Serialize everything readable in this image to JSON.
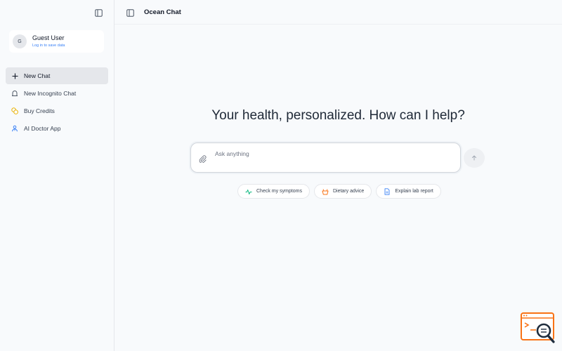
{
  "sidebar": {
    "user": {
      "initial": "G",
      "name": "Guest User",
      "subtitle": "Log in to save data"
    },
    "items": [
      {
        "label": "New Chat",
        "icon": "plus-icon",
        "active": true
      },
      {
        "label": "New Incognito Chat",
        "icon": "incognito-icon"
      },
      {
        "label": "Buy Credits",
        "icon": "coins-icon",
        "color": "#eab308"
      },
      {
        "label": "AI Doctor App",
        "icon": "doctor-icon",
        "color": "#3b82f6"
      }
    ]
  },
  "header": {
    "title": "Ocean Chat"
  },
  "main": {
    "headline": "Your health, personalized. How can I help?",
    "composer": {
      "placeholder": "Ask anything",
      "value": ""
    },
    "chips": [
      {
        "label": "Check my symptoms",
        "icon": "pulse-icon",
        "color": "#10b981"
      },
      {
        "label": "Dietary advice",
        "icon": "bowl-icon",
        "color": "#f97316"
      },
      {
        "label": "Explain lab report",
        "icon": "document-icon",
        "color": "#3b82f6"
      }
    ]
  },
  "colors": {
    "accent": "#3b82f6",
    "coin": "#eab308",
    "pulse": "#10b981",
    "diet": "#f97316",
    "logo": "#f97316"
  }
}
